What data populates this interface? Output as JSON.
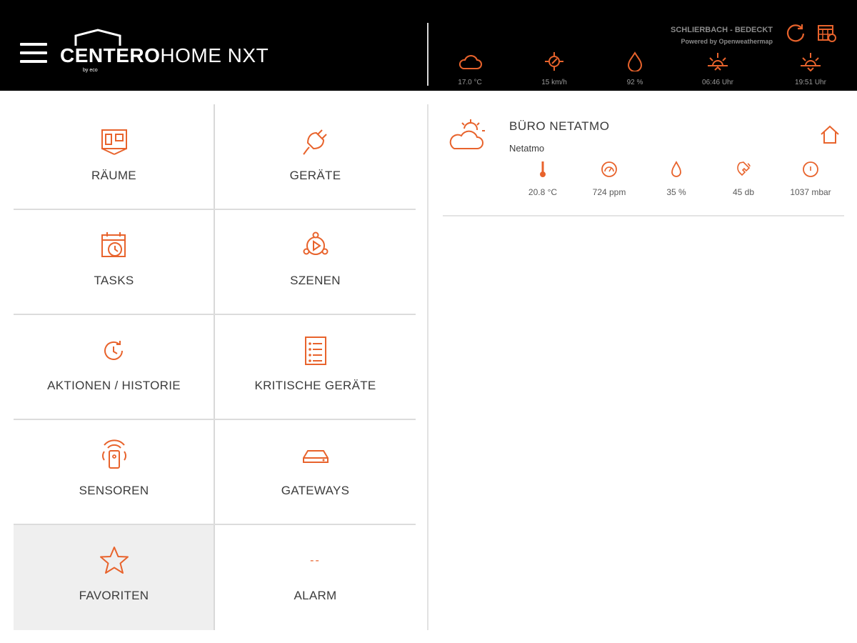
{
  "header": {
    "brand": {
      "bold": "CENTERO",
      "light": "HOME NXT",
      "sub": "by eco"
    },
    "weather": {
      "location": "SCHLIERBACH - BEDECKT",
      "powered_by": "Powered by Openweathermap",
      "items": [
        {
          "icon": "cloud-icon",
          "value": "17.0 °C"
        },
        {
          "icon": "wind-icon",
          "value": "15 km/h"
        },
        {
          "icon": "humidity-drop-icon",
          "value": "92 %"
        },
        {
          "icon": "sunrise-icon",
          "value": "06:46 Uhr"
        },
        {
          "icon": "sunset-icon",
          "value": "19:51 Uhr"
        }
      ]
    },
    "actions": [
      {
        "icon": "refresh-icon"
      },
      {
        "icon": "calendar-grid-icon"
      }
    ]
  },
  "menu": {
    "tiles": [
      {
        "label": "RÄUME",
        "icon": "rooms-icon"
      },
      {
        "label": "GERÄTE",
        "icon": "plug-icon"
      },
      {
        "label": "TASKS",
        "icon": "calendar-clock-icon"
      },
      {
        "label": "SZENEN",
        "icon": "scene-play-icon"
      },
      {
        "label": "AKTIONEN / HISTORIE",
        "icon": "history-icon"
      },
      {
        "label": "KRITISCHE GERÄTE",
        "icon": "checklist-icon"
      },
      {
        "label": "SENSOREN",
        "icon": "sensor-icon"
      },
      {
        "label": "GATEWAYS",
        "icon": "gateway-icon"
      },
      {
        "label": "FAVORITEN",
        "icon": "star-icon"
      },
      {
        "label": "ALARM",
        "icon": "alarm-dashes-icon",
        "glyph": "--"
      }
    ],
    "active": "FAVORITEN"
  },
  "device_card": {
    "title": "BÜRO NETATMO",
    "subtitle": "Netatmo",
    "icon": "partly-cloudy-icon",
    "home_icon": "home-icon",
    "metrics": [
      {
        "icon": "thermometer-icon",
        "value": "20.8 °C"
      },
      {
        "icon": "co2-gauge-icon",
        "value": "724 ppm"
      },
      {
        "icon": "drop-icon",
        "value": "35 %"
      },
      {
        "icon": "sound-icon",
        "value": "45 db"
      },
      {
        "icon": "pressure-icon",
        "value": "1037 mbar"
      }
    ]
  },
  "colors": {
    "accent": "#e8632c",
    "header_bg": "#000000",
    "active_tile_bg": "#efefef",
    "divider": "#dcdcdc"
  }
}
